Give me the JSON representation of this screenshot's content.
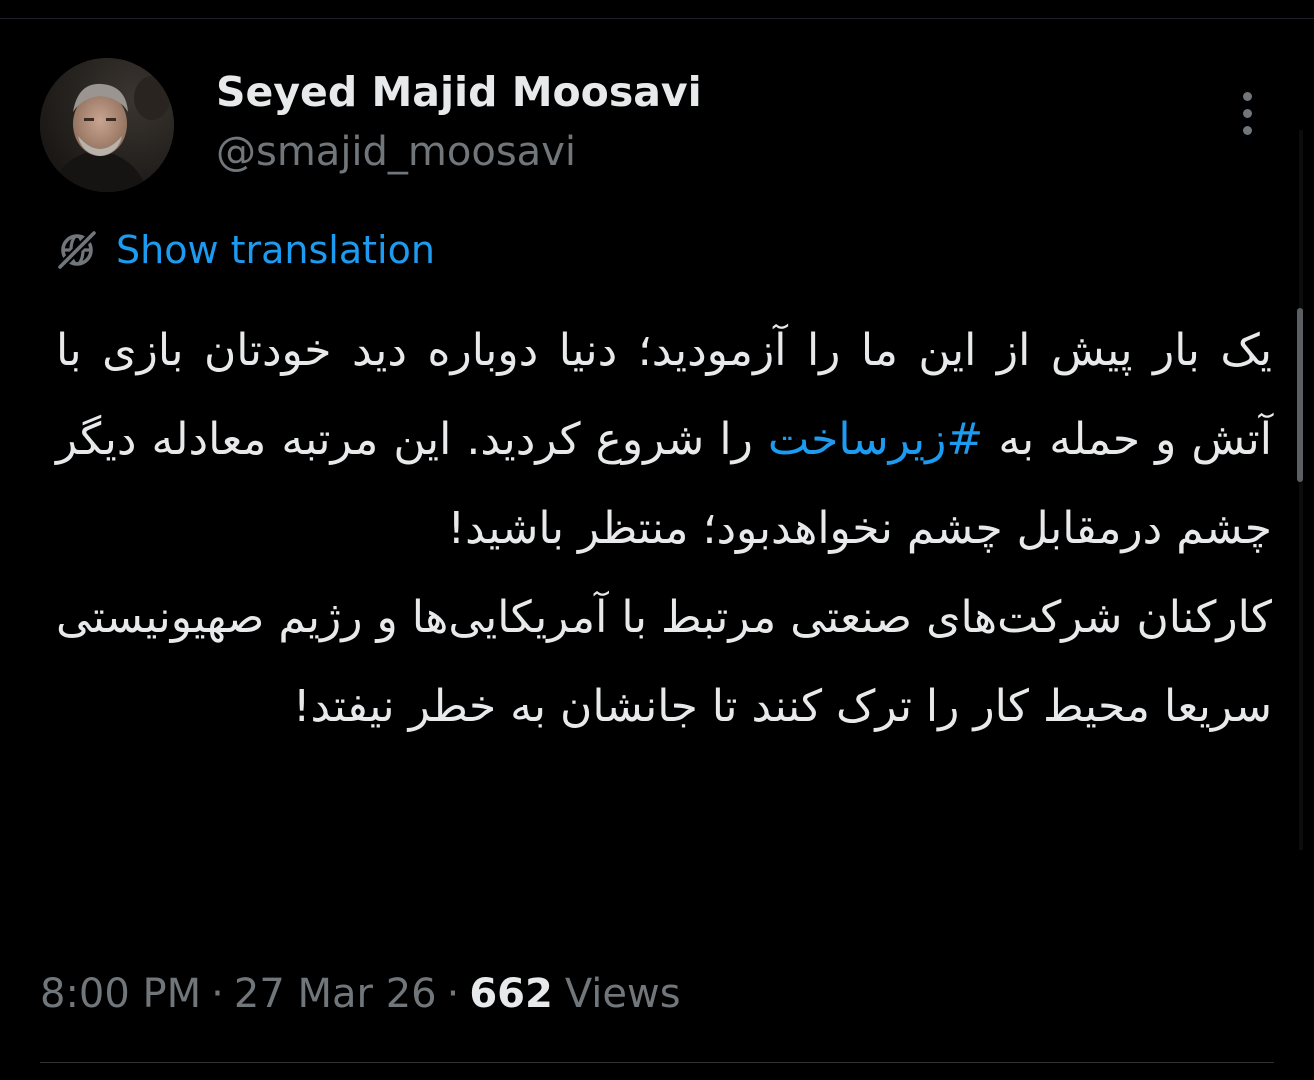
{
  "theme": {
    "background": "#000000",
    "text_primary": "#e7e9ea",
    "text_secondary": "#71767b",
    "accent": "#1d9bf0"
  },
  "author": {
    "display_name": "Seyed Majid Moosavi",
    "handle": "@smajid_moosavi"
  },
  "icons": {
    "more": "more-vertical-icon",
    "translate": "globe-slash-icon"
  },
  "translation": {
    "label": "Show translation"
  },
  "tweet": {
    "p1_a": "یک بار پیش از این ما را آزمودید؛ دنیا دوباره دید خودتان بازی با آتش و حمله به ",
    "hashtag": "#زیرساخت",
    "p1_b": " را شروع کردید. این مرتبه معادله دیگر چشم درمقابل چشم نخواهدبود؛ منتظر باشید!",
    "p2": "کارکنان شرکت‌های صنعتی مرتبط با آمریکایی‌ها و رژیم صهیونیستی سریعا محیط کار را ترک کنند تا جانشان به خطر نیفتد!"
  },
  "meta": {
    "time": "8:00 PM",
    "date": "27 Mar 26",
    "separator": "·",
    "views_count": "662",
    "views_label": "Views"
  }
}
